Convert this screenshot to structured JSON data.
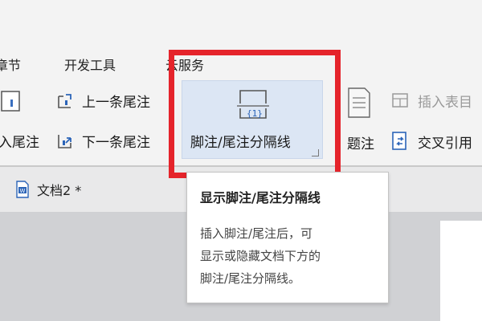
{
  "menu": {
    "items": [
      {
        "label": "章节"
      },
      {
        "label": "开发工具"
      },
      {
        "label": "云服务"
      }
    ]
  },
  "ribbon": {
    "insert_endnote_left": "入尾注",
    "prev_endnote": "上一条尾注",
    "next_endnote": "下一条尾注",
    "separator_button": "脚注/尾注分隔线",
    "separator_icon_text": "{1}",
    "endnote_partial": "题注",
    "insert_table_caption": "插入表目",
    "cross_reference": "交叉引用"
  },
  "tabs": {
    "doc_name": "文档2 *"
  },
  "tooltip": {
    "title": "显示脚注/尾注分隔线",
    "line1": "插入脚注/尾注后，可",
    "line2": "显示或隐藏文档下方的",
    "line3": "脚注/尾注分隔线。"
  },
  "colors": {
    "highlight": "#e5242b",
    "active_button_bg": "#dce6f4",
    "icon_blue": "#2b64b8"
  }
}
